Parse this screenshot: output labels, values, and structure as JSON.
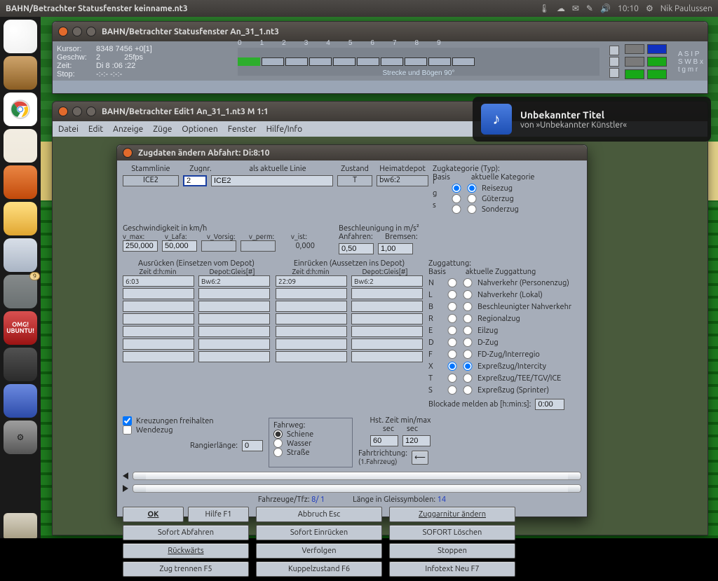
{
  "topbar": {
    "title": "BAHN/Betrachter Statusfenster keinname.nt3",
    "time": "10:10",
    "user": "Nik Paulussen"
  },
  "launcher": {
    "badge_updates": "9",
    "omg_text": "OMG!\nUBUNTU!"
  },
  "status_window": {
    "title": "BAHN/Betrachter Statusfenster An_31_1.nt3",
    "labels": {
      "kursor": "Kursor:",
      "geschw": "Geschw:",
      "zeit": "Zeit:",
      "stop": "Stop:"
    },
    "kursor": "8348 7456 +0[1]",
    "geschw_a": "2",
    "geschw_b": "25fps",
    "zeit": "Di    8 :06 :22",
    "stop": "-:-:- -:-:-",
    "track_nums": [
      "0",
      "1",
      "2",
      "3",
      "4",
      "5",
      "6",
      "7",
      "8",
      "9"
    ],
    "track_foot": "Strecke und Bögen 90°",
    "letters_row1": "A   S   I   P",
    "letters_row2": "S  W  B  x",
    "letters_row3": "t   g   m   r"
  },
  "edit_window": {
    "title": "BAHN/Betrachter Edit1 An_31_1.nt3 M 1:1",
    "menu": [
      "Datei",
      "Edit",
      "Anzeige",
      "Züge",
      "Optionen",
      "Fenster",
      "Hilfe/Info"
    ]
  },
  "notification": {
    "title": "Unbekannter Titel",
    "subtitle": "von »Unbekannter Künstler«"
  },
  "dialog": {
    "title": "Zugdaten ändern    Abfahrt: Di:8:10",
    "top": {
      "stammlinie_lbl": "Stammlinie",
      "stammlinie": "ICE2",
      "zugnr_lbl": "Zugnr.",
      "zugnr": "2",
      "als_lbl": "als aktuelle Linie",
      "als": "ICE2",
      "zustand_lbl": "Zustand",
      "zustand": "T",
      "heimat_lbl": "Heimatdepot",
      "heimat": "bw6:2",
      "kat_lbl": "Zugkategorie (Typ):",
      "basis_lbl": "Basis",
      "akt_lbl": "aktuelle Kategorie",
      "basis_opts": [
        "r",
        "g",
        "s"
      ],
      "kat_opts": [
        "Reisezug",
        "Güterzug",
        "Sonderzug"
      ]
    },
    "speed": {
      "heading": "Geschwindigkeit in km/h",
      "cols": [
        "v_max:",
        "v_Lafa:",
        "v_Vorsig:",
        "v_perm:",
        "v_ist:"
      ],
      "vmax": "250,000",
      "vlafa": "50,000",
      "vvorsig": "",
      "vperm": "",
      "vist": "0,000",
      "accel_heading": "Beschleunigung in m/s²",
      "anfahren_lbl": "Anfahren:",
      "bremsen_lbl": "Bremsen:",
      "anfahren": "0,50",
      "bremsen": "1,00"
    },
    "depot": {
      "aus_lbl": "Ausrücken (Einsetzen vom Depot)",
      "ein_lbl": "Einrücken (Aussetzen ins Depot)",
      "sub_a": "Zeit d:h:min",
      "sub_b": "Depot:Gleis[#]",
      "aus_time": "6:03",
      "aus_depot": "Bw6:2",
      "ein_time": "22:09",
      "ein_depot": "Bw6:2"
    },
    "gattung": {
      "heading": "Zuggattung:",
      "basis": "Basis",
      "akt": "aktuelle Zuggattung",
      "rows": [
        {
          "k": "N",
          "t": "Nahverkehr (Personenzug)"
        },
        {
          "k": "L",
          "t": "Nahverkehr (Lokal)"
        },
        {
          "k": "B",
          "t": "Beschleunigter Nahverkehr"
        },
        {
          "k": "R",
          "t": "Regionalzug"
        },
        {
          "k": "E",
          "t": "Eilzug"
        },
        {
          "k": "D",
          "t": "D-Zug"
        },
        {
          "k": "F",
          "t": "FD-Zug/Interregio"
        },
        {
          "k": "X",
          "t": "Expreßzug/Intercity"
        },
        {
          "k": "T",
          "t": "Expreßzug/TEE/TGV/ICE"
        },
        {
          "k": "S",
          "t": "Expreßzug (Sprinter)"
        }
      ],
      "selected_basis": "X",
      "selected_akt": "X"
    },
    "misc": {
      "kreuz": "Kreuzungen freihalten",
      "wende": "Wendezug",
      "rangier_lbl": "Rangierlänge:",
      "rangier": "0",
      "fahrweg_lbl": "Fahrweg:",
      "fahrweg_opts": [
        "Schiene",
        "Wasser",
        "Straße"
      ],
      "hst_lbl": "Hst. Zeit min/max",
      "sec": "sec",
      "hst_min": "60",
      "hst_max": "120",
      "richtung_lbl": "Fahrtrichtung:",
      "richtung_sub": "(1.Fahrzeug)",
      "blockade_lbl": "Blockade melden ab [h:min:s]:",
      "blockade": "0:00"
    },
    "consist": {
      "fahrzeuge_lbl": "Fahrzeuge/Tfz:",
      "fahrzeuge": "8/   1",
      "laenge_lbl": "Länge in Gleissymbolen:",
      "laenge": "14"
    },
    "buttons": {
      "ok": "OK",
      "hilfe": "Hilfe   F1",
      "abbruch": "Abbruch  Esc",
      "garnitur": "Zuggarnitur ändern",
      "sofort_ab": "Sofort Abfahren",
      "sofort_ein": "Sofort Einrücken",
      "sofort_loesch": "SOFORT Löschen",
      "rueck": "Rückwärts",
      "verfolgen": "Verfolgen",
      "stoppen": "Stoppen",
      "trennen": "Zug trennen      F5",
      "kuppel": "Kuppelzustand   F6",
      "infotext": "Infotext Neu     F7"
    }
  }
}
